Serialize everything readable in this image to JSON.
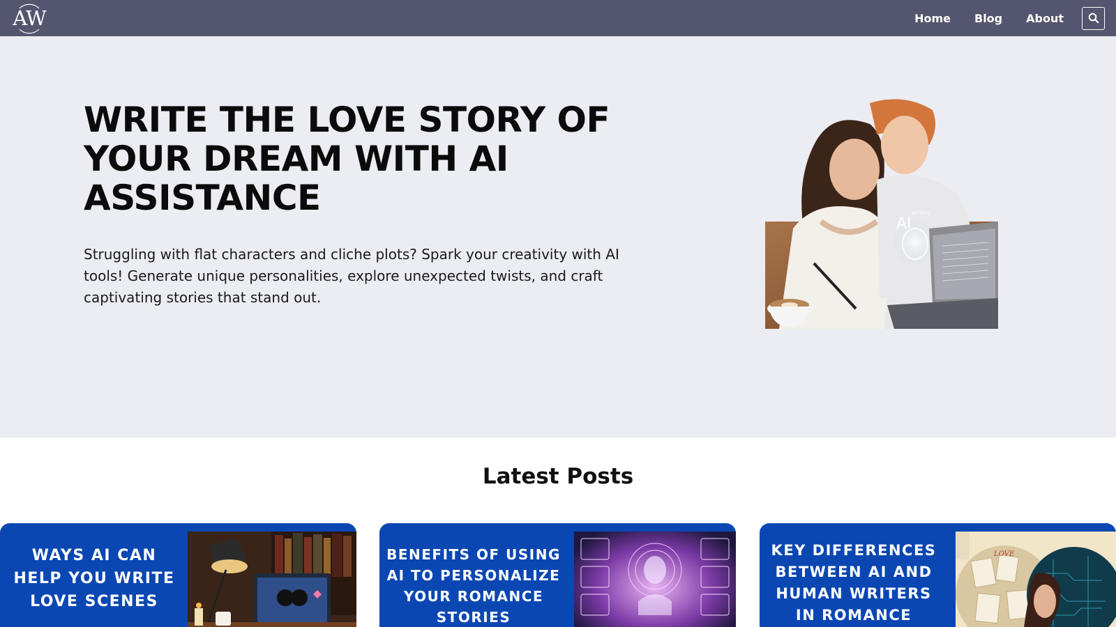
{
  "header": {
    "logo_text": "AW",
    "nav": [
      {
        "label": "Home"
      },
      {
        "label": "Blog"
      },
      {
        "label": "About"
      }
    ],
    "search_icon": "search-icon"
  },
  "hero": {
    "title": "WRITE THE LOVE STORY OF YOUR DREAM WITH AI ASSISTANCE",
    "description": "Struggling with flat characters and cliche plots? Spark your creativity with AI tools! Generate unique personalities, explore unexpected twists, and craft captivating stories that stand out.",
    "image_overlay_text": "AI",
    "image_overlay_small": "writing"
  },
  "latest_posts": {
    "title": "Latest Posts",
    "cards": [
      {
        "title": "WAYS AI CAN HELP YOU WRITE LOVE SCENES"
      },
      {
        "title": "BENEFITS OF USING AI TO PERSONALIZE YOUR ROMANCE STORIES"
      },
      {
        "title": "KEY DIFFERENCES BETWEEN AI AND HUMAN WRITERS IN ROMANCE FICTION",
        "image_label": "LOVE"
      }
    ]
  },
  "colors": {
    "header_bg": "#54556e",
    "hero_bg": "#ececf3",
    "card_bg": "#0a47b3"
  }
}
